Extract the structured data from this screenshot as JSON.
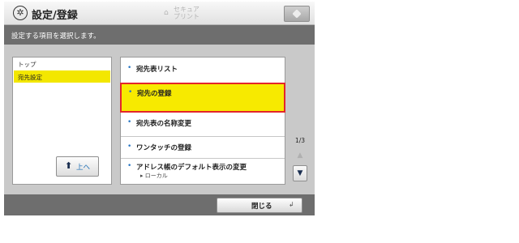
{
  "header": {
    "title": "設定/登録",
    "secure_print_line1": "セキュア",
    "secure_print_line2": "プリント",
    "settings_icon": "settings-gear-icon",
    "home_icon": "home-icon"
  },
  "instruction": "設定する項目を選択します。",
  "tree": {
    "items": [
      {
        "label": "トップ",
        "selected": false
      },
      {
        "label": "宛先設定",
        "selected": true
      }
    ],
    "up_button_label": "上へ"
  },
  "list": {
    "items": [
      {
        "label": "宛先表リスト",
        "selected": false
      },
      {
        "label": "宛先の登録",
        "selected": true
      },
      {
        "label": "宛先表の名称変更",
        "selected": false
      },
      {
        "label": "ワンタッチの登録",
        "selected": false
      },
      {
        "label": "アドレス帳のデフォルト表示の変更",
        "sub": "ローカル",
        "selected": false
      }
    ],
    "page_indicator": "1/3"
  },
  "footer": {
    "close_label": "閉じる"
  },
  "colors": {
    "selection": "#f7ea00",
    "highlight_border": "#e3262a",
    "bar": "#6e6e6e",
    "accent": "#2b78c5"
  }
}
